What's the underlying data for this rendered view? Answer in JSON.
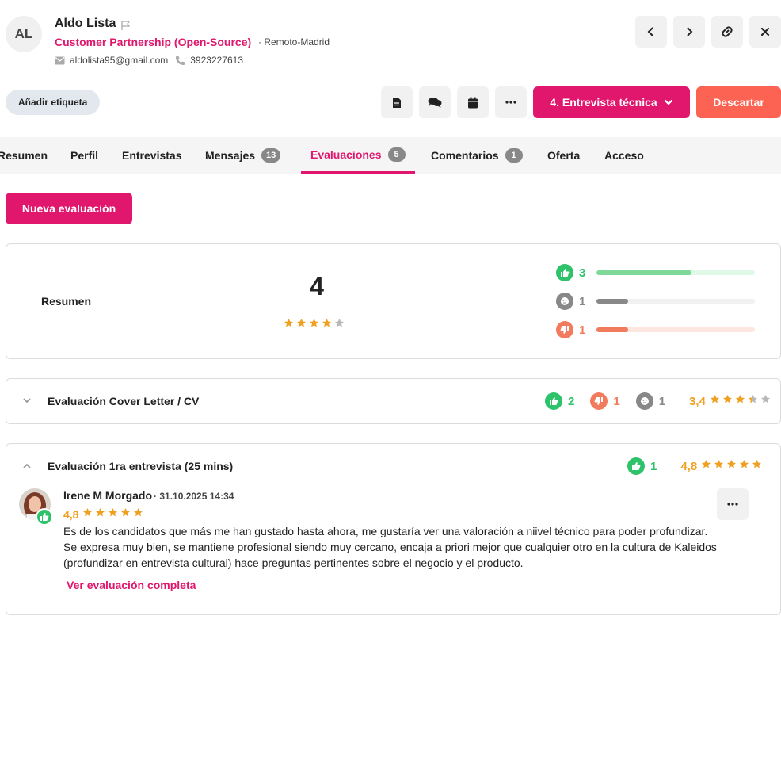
{
  "candidate": {
    "initials": "AL",
    "name": "Aldo Lista",
    "job": "Customer Partnership (Open-Source)",
    "location": "· Remoto-Madrid",
    "email": "aldolista95@gmail.com",
    "phone": "3923227613"
  },
  "actions": {
    "add_tag": "Añadir etiqueta",
    "stage": "4. Entrevista técnica",
    "discard": "Descartar",
    "new_evaluation": "Nueva evaluación"
  },
  "tabs": [
    {
      "label": "Resumen"
    },
    {
      "label": "Perfil"
    },
    {
      "label": "Entrevistas"
    },
    {
      "label": "Mensajes",
      "badge": "13"
    },
    {
      "label": "Evaluaciones",
      "badge": "5"
    },
    {
      "label": "Comentarios",
      "badge": "1"
    },
    {
      "label": "Oferta"
    },
    {
      "label": "Acceso"
    }
  ],
  "summary": {
    "label": "Resumen",
    "score": "4",
    "stars": 4,
    "positive": {
      "count": "3",
      "fraction": 0.6
    },
    "neutral": {
      "count": "1",
      "fraction": 0.2
    },
    "negative": {
      "count": "1",
      "fraction": 0.2
    }
  },
  "evaluations": [
    {
      "title": "Evaluación Cover Letter / CV",
      "positive": "2",
      "negative": "1",
      "neutral": "1",
      "rating": "3,4",
      "rating_value": 3.4
    },
    {
      "title": "Evaluación 1ra entrevista (25 mins)",
      "positive": "1",
      "rating": "4,8",
      "rating_value": 4.8,
      "review": {
        "author": "Irene M Morgado",
        "date": "· 31.10.2025 14:34",
        "rating": "4,8",
        "rating_value": 4.8,
        "text": "Es de los candidatos que más me han gustado hasta ahora, me gustaría ver una valoración a niivel técnico para poder profundizar. Se expresa muy bien, se mantiene profesional siendo muy cercano, encaja a priori mejor que cualquier otro en la cultura de Kaleidos (profundizar en entrevista cultural) hace preguntas pertinentes sobre el negocio y el producto.",
        "link": "Ver evaluación completa"
      }
    }
  ],
  "colors": {
    "accent": "#e0176d",
    "discard": "#fd6352",
    "positive": "#2ec26b",
    "neutral": "#888888",
    "negative": "#f27b5e",
    "star": "#f0a020"
  }
}
